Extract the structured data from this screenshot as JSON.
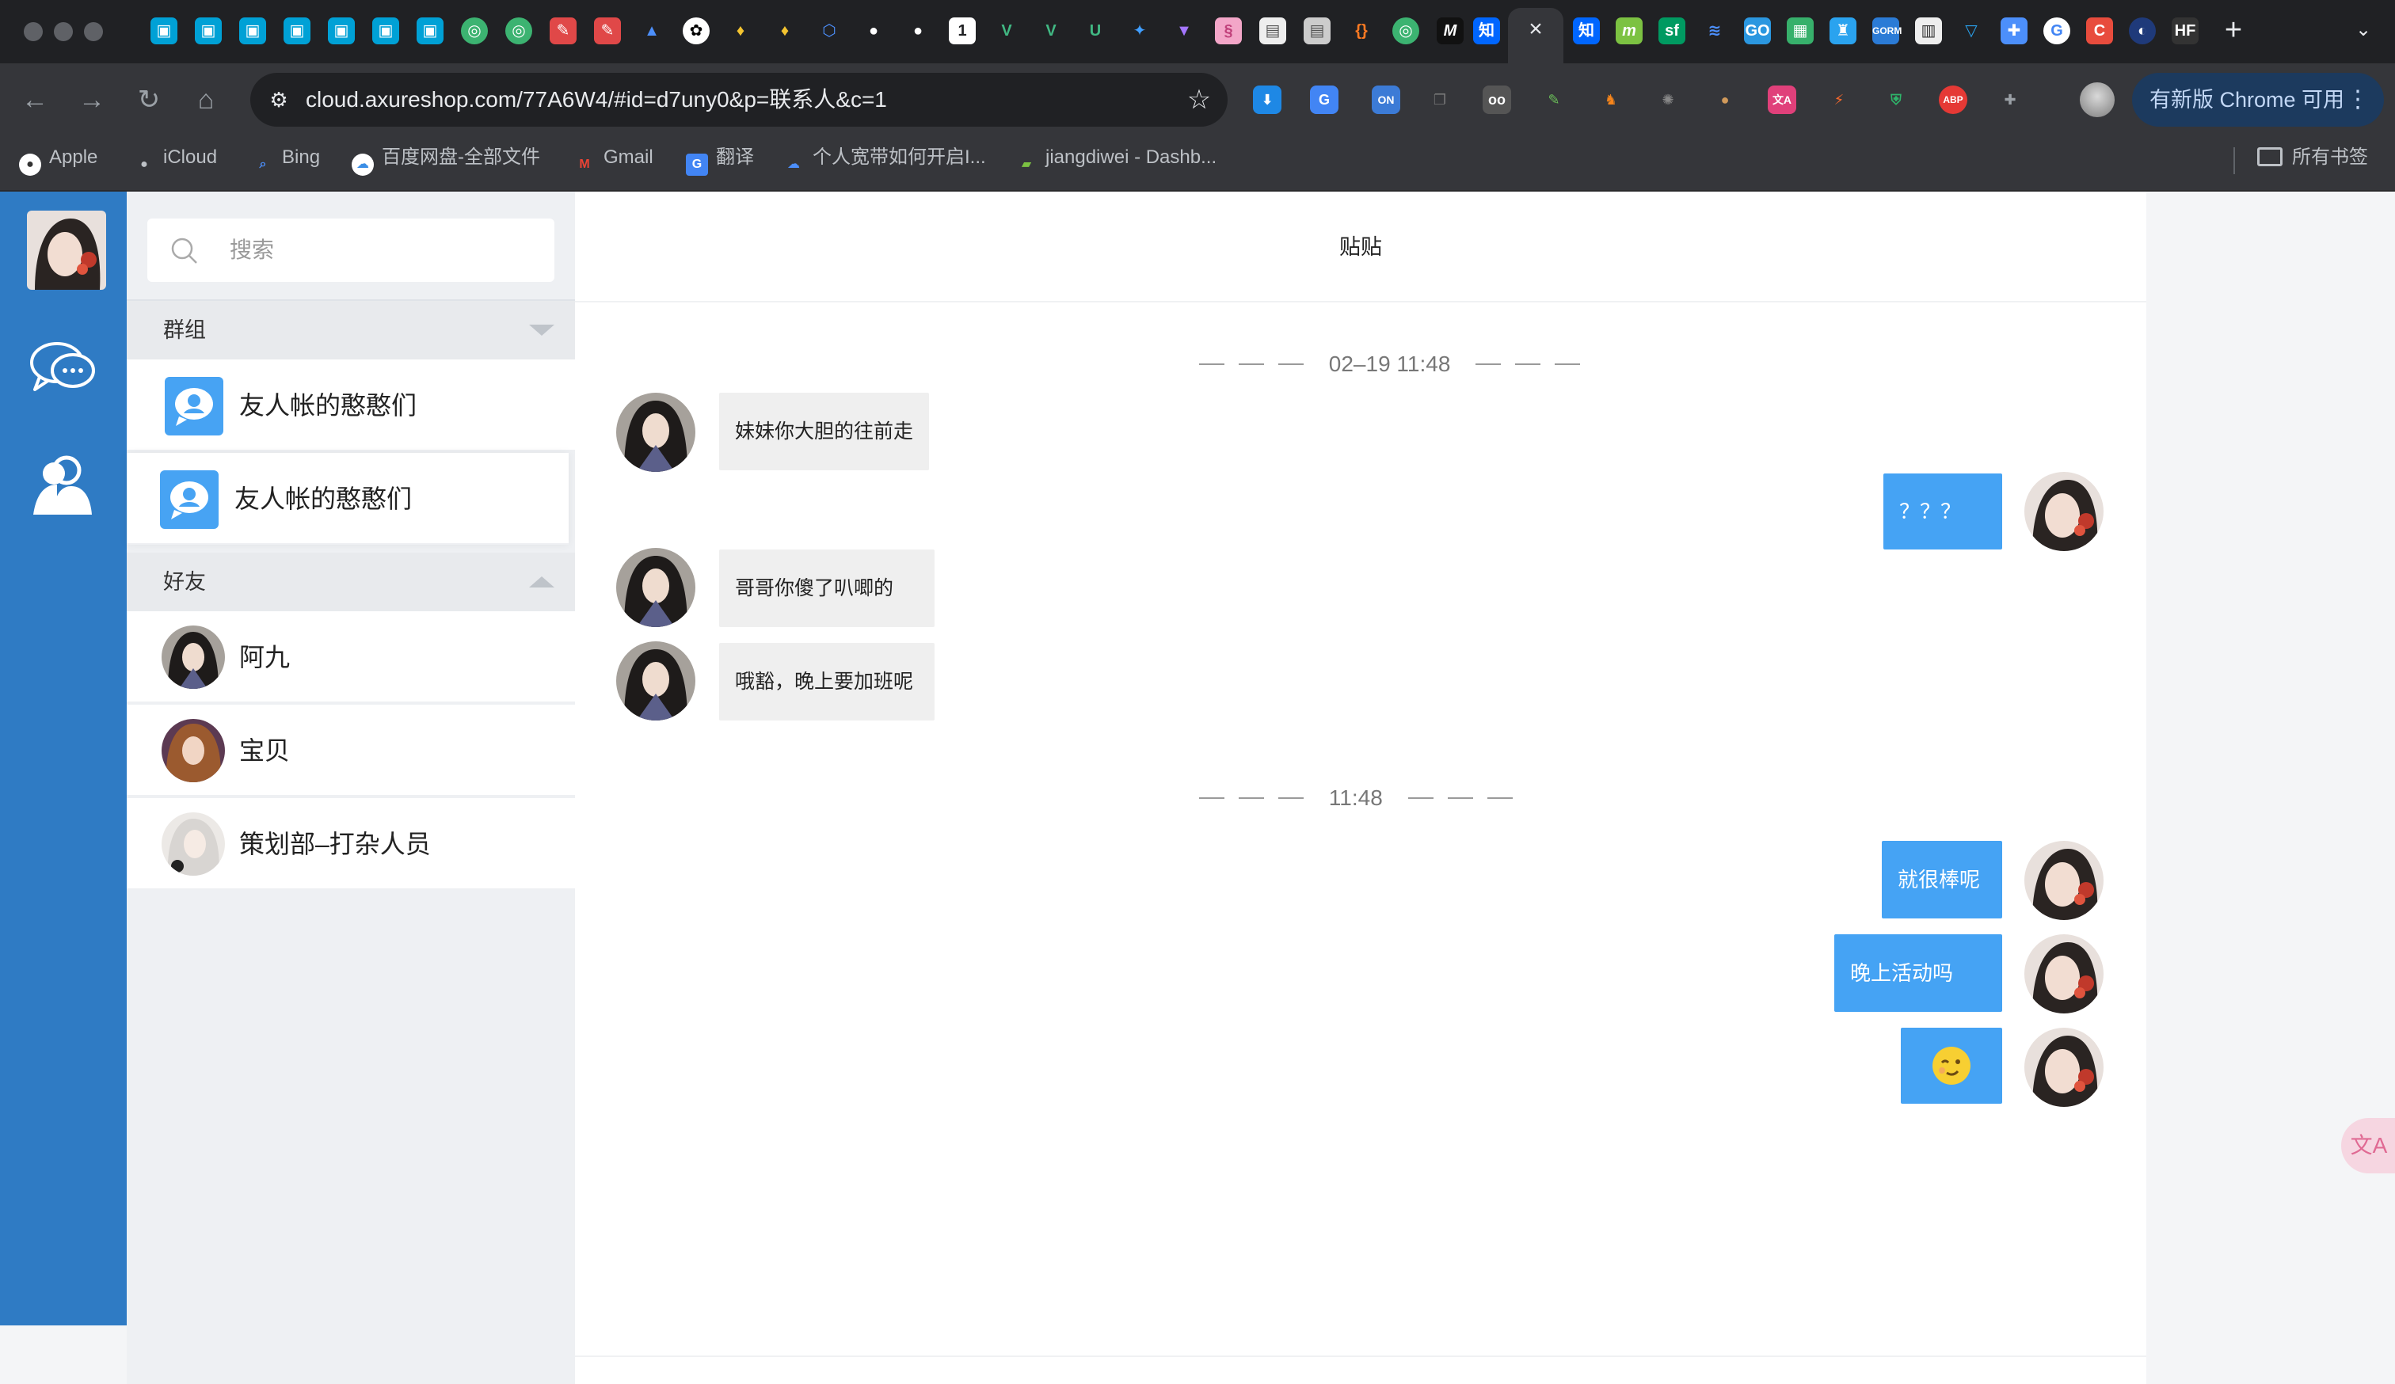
{
  "browser": {
    "url": "cloud.axureshop.com/77A6W4/#id=d7uny0&p=联系人&c=1",
    "update_button_label": "有新版 Chrome 可用",
    "bookmarks": [
      {
        "label": "Apple",
        "icon": "apple-icon"
      },
      {
        "label": "iCloud",
        "icon": "apple-icon"
      },
      {
        "label": "Bing",
        "icon": "search-icon"
      },
      {
        "label": "百度网盘-全部文件",
        "icon": "baidu-netdisk-icon"
      },
      {
        "label": "Gmail",
        "icon": "gmail-icon"
      },
      {
        "label": "翻译",
        "icon": "translate-icon"
      },
      {
        "label": "个人宽带如何开启I...",
        "icon": "cloud-icon"
      },
      {
        "label": "jiangdiwei - Dashb...",
        "icon": "dashboard-icon"
      }
    ],
    "bookmarks_folder": "所有书签",
    "tab_icons": [
      "bilibili",
      "bilibili",
      "bilibili",
      "bilibili",
      "bilibili",
      "bilibili",
      "bilibili",
      "lanhu",
      "lanhu",
      "xiaohongshu",
      "xiaohongshu",
      "atlassian",
      "openai",
      "pineapple",
      "pineapple",
      "arcgis",
      "github",
      "github",
      "number-1",
      "vue",
      "vue",
      "u",
      "element",
      "vite",
      "fingerprint",
      "photo",
      "photo",
      "json",
      "lanhu",
      "m",
      "zhihu"
    ],
    "tab_icons_after_active": [
      "zhihu",
      "m",
      "sf",
      "layers",
      "go",
      "sheet",
      "tea",
      "gorm",
      "reader",
      "drink",
      "puzzle",
      "google",
      "c-logo",
      "globe",
      "hf"
    ],
    "extensions": [
      "download",
      "google-translate",
      "on-badge",
      "copy",
      "glasses",
      "feather",
      "metamask",
      "gear",
      "cookie",
      "translate",
      "bolt",
      "shield",
      "abp",
      "puzzle"
    ],
    "accent_color": "#2f7bc4"
  },
  "app": {
    "nav_colors": {
      "sidebar": "#2f7bc4",
      "bubble_out": "#45a3f4",
      "bubble_in": "#efefef"
    },
    "search": {
      "placeholder": "搜索"
    },
    "groups": {
      "title": "群组",
      "items": [
        {
          "name": "友人帐的憨憨们"
        },
        {
          "name": "友人帐的憨憨们"
        }
      ]
    },
    "friends": {
      "title": "好友",
      "items": [
        {
          "name": "阿九"
        },
        {
          "name": "宝贝"
        },
        {
          "name": "策划部–打杂人员"
        }
      ]
    },
    "chat": {
      "title": "贴贴",
      "timestamps": [
        "02–19 11:48",
        "11:48"
      ],
      "messages": [
        {
          "side": "in",
          "text": "妹妹你大胆的往前走"
        },
        {
          "side": "out",
          "text": "？？？"
        },
        {
          "side": "in",
          "text": "哥哥你傻了叭唧的"
        },
        {
          "side": "in",
          "text": "哦豁，晚上要加班呢"
        },
        {
          "side": "out",
          "text": "就很棒呢"
        },
        {
          "side": "out",
          "text": "晚上活动吗"
        },
        {
          "side": "out",
          "text": "",
          "emoji": "wink-emoji"
        }
      ]
    }
  }
}
